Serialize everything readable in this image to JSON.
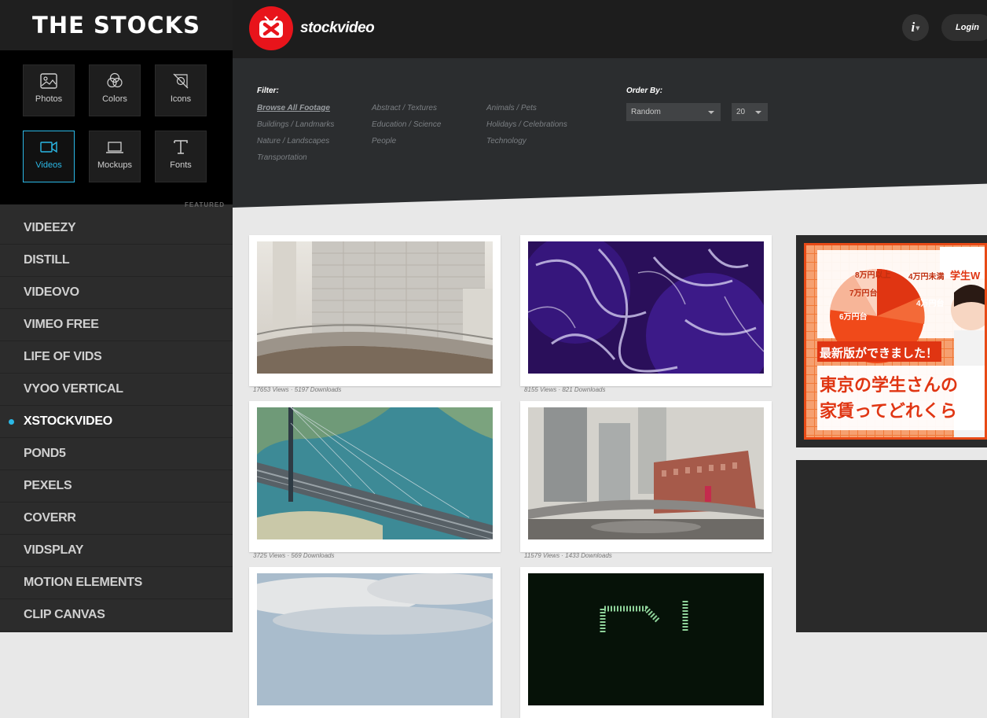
{
  "sidebar": {
    "brand": "THE STOCKS",
    "categories": [
      {
        "label": "Photos",
        "icon": "photo-icon"
      },
      {
        "label": "Colors",
        "icon": "colors-icon"
      },
      {
        "label": "Icons",
        "icon": "icons-icon"
      },
      {
        "label": "Videos",
        "icon": "video-camera-icon",
        "active": true
      },
      {
        "label": "Mockups",
        "icon": "laptop-icon"
      },
      {
        "label": "Fonts",
        "icon": "font-icon"
      }
    ],
    "featured_label": "FEATURED",
    "sites": [
      "VIDEEZY",
      "DISTILL",
      "VIDEOVO",
      "VIMEO FREE",
      "LIFE OF VIDS",
      "VYOO VERTICAL",
      "XSTOCKVIDEO",
      "POND5",
      "PEXELS",
      "COVERR",
      "VIDSPLAY",
      "MOTION ELEMENTS",
      "CLIP CANVAS"
    ],
    "active_site": "XSTOCKVIDEO"
  },
  "topbar": {
    "logo_text": "stockvideo",
    "info_label": "i",
    "login_label": "Login"
  },
  "filter": {
    "title": "Filter:",
    "links": [
      "Browse All Footage",
      "Abstract / Textures",
      "Animals / Pets",
      "Buildings / Landmarks",
      "Education / Science",
      "Holidays / Celebrations",
      "Nature / Landscapes",
      "People",
      "Technology",
      "Transportation"
    ],
    "active_link": "Browse All Footage"
  },
  "order": {
    "title": "Order By:",
    "sort_value": "Random",
    "count_value": "20"
  },
  "videos": [
    {
      "views": "17653",
      "downloads": "5197",
      "stats": "17653 Views · 5197 Downloads"
    },
    {
      "views": "8155",
      "downloads": "821",
      "stats": "8155 Views · 821 Downloads"
    },
    {
      "views": "3725",
      "downloads": "569",
      "stats": "3725 Views · 569 Downloads"
    },
    {
      "views": "11579",
      "downloads": "1433",
      "stats": "11579 Views · 1433 Downloads"
    }
  ],
  "ad": {
    "brand": "学生W",
    "pie_labels": [
      "8万円以上",
      "4万円未満",
      "7万円台",
      "4万円台",
      "6万円台"
    ],
    "banner": "最新版ができました！",
    "headline_1": "東京の学生さんの",
    "headline_2": "家賃ってどれくら"
  },
  "colors": {
    "accent": "#2bb8e6",
    "logo_red": "#e8141b",
    "ad_orange": "#e84a16"
  }
}
